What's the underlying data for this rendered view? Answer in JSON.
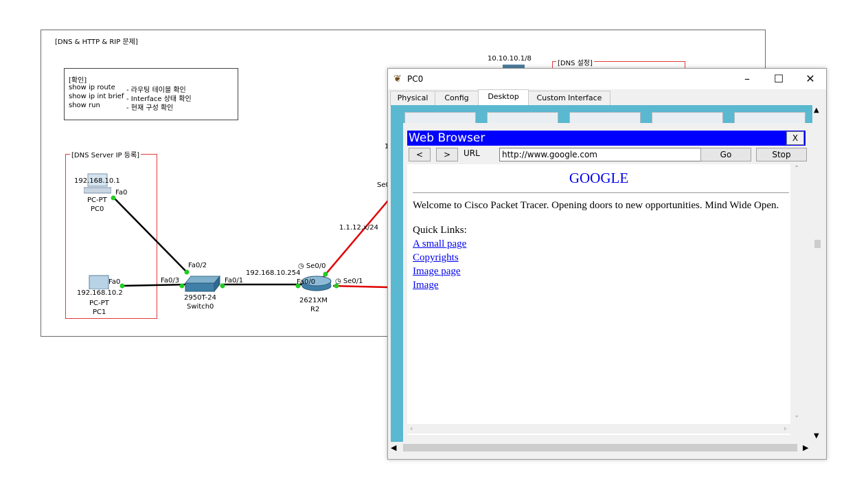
{
  "workspace": {
    "header": "[DNS & HTTP & RIP 문제]",
    "check_box": {
      "title": "[확인]",
      "lines": [
        {
          "cmd": "show ip route",
          "desc": "- 라우팅 테이블 확인"
        },
        {
          "cmd": "show ip int brief",
          "desc": "- Interface 상태 확인"
        },
        {
          "cmd": "show run",
          "desc": "- 현재 구성 확인"
        }
      ]
    },
    "dns_area_label": "[DNS Server IP 등록]",
    "dns_setting_label": "[DNS 설정]",
    "server_ip": "10.10.10.1/8",
    "pc0": {
      "ip": "192.168.10.1",
      "port": "Fa0",
      "model": "PC-PT",
      "name": "PC0"
    },
    "pc1": {
      "ip": "192.168.10.2",
      "port": "Fa0",
      "model": "PC-PT",
      "name": "PC1"
    },
    "switch": {
      "model": "2950T-24",
      "name": "Switch0",
      "port_to_pc0": "Fa0/2",
      "port_to_pc1": "Fa0/3",
      "port_to_router": "Fa0/1"
    },
    "router": {
      "model": "2621XM",
      "name": "R2",
      "lan_ip": "192.168.10.254",
      "lan_port": "Fa0/0",
      "port_up": "Se0/0",
      "port_right": "Se0/1"
    },
    "wan_net": "1.1.12.x/24",
    "partial_label_se": "Se0",
    "partial_label_1": "1"
  },
  "window": {
    "title": "PC0",
    "controls": {
      "minimize": "–",
      "maximize": "☐",
      "close": "✕"
    },
    "tabs": [
      {
        "label": "Physical",
        "active": false
      },
      {
        "label": "Config",
        "active": false
      },
      {
        "label": "Desktop",
        "active": true
      },
      {
        "label": "Custom Interface",
        "active": false
      }
    ]
  },
  "browser": {
    "title": "Web Browser",
    "close_label": "X",
    "back_label": "<",
    "forward_label": ">",
    "url_label": "URL",
    "url_value": "http://www.google.com",
    "go_label": "Go",
    "stop_label": "Stop",
    "page": {
      "heading": "GOOGLE",
      "welcome": "Welcome to Cisco Packet Tracer. Opening doors to new opportunities. Mind Wide Open.",
      "quick_links_label": "Quick Links:",
      "links": [
        "A small page",
        "Copyrights",
        "Image page",
        "Image"
      ]
    }
  },
  "colors": {
    "link": "#0000ee",
    "browser_title_bg": "#0000ff",
    "desktop_bg": "#5ab8d0",
    "serial_link": "#e00000",
    "port_up": "#22cc22"
  }
}
